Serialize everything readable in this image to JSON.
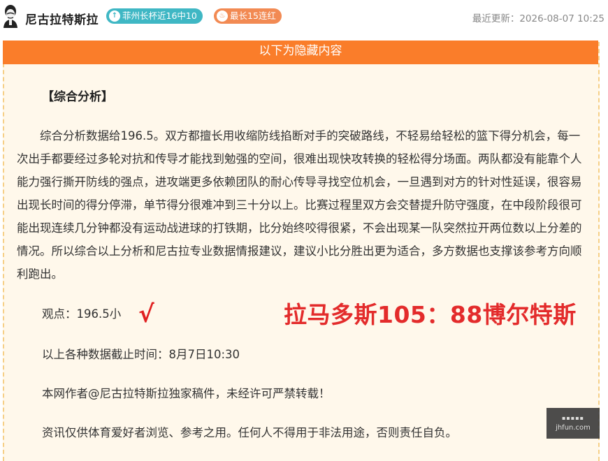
{
  "header": {
    "author": "尼古拉特斯拉",
    "badges": [
      {
        "icon": "up-arrow-icon",
        "label": "菲州长杯近16中10",
        "color": "#3fb7c4"
      },
      {
        "icon": "fire-icon",
        "label": "最长15连红",
        "color": "#f28a53"
      }
    ],
    "updated": "最近更新：2026-08-07 10:25"
  },
  "banner": "以下为隐藏内容",
  "article": {
    "section_title": "【综合分析】",
    "body": "综合分析数据给196.5。双方都擅长用收缩防线掐断对手的突破路线，不轻易给轻松的篮下得分机会，每一次出手都要经过多轮对抗和传导才能找到勉强的空间，很难出现快攻转换的轻松得分场面。两队都没有能靠个人能力强行撕开防线的强点，进攻端更多依赖团队的耐心传导寻找空位机会，一旦遇到对方的针对性延误，很容易出现长时间的得分停滞，单节得分很难冲到三十分以上。比赛过程里双方会交替提升防守强度，在中段阶段很可能出现连续几分钟都没有运动战进球的打铁期，比分始终咬得很紧，不会出现某一队突然拉开两位数以上分差的情况。所以综合以上分析和尼古拉专业数据情报建议，建议小比分胜出更为适合，多方数据也支撑该参考方向顺利跑出。",
    "viewpoint": "观点：196.5小",
    "check_mark": "√",
    "result": "拉马多斯105：88博尔特斯",
    "deadline": "以上各种数据截止时间：8月7日10:30",
    "copyright": "本网作者@尼古拉特斯拉独家稿件，未经许可严禁转载！",
    "disclaimer": "资讯仅供体育爱好者浏览、参考之用。任何人不得用于非法用途，否则责任自负。"
  },
  "watermark": {
    "top": "▪▪▪▪▪",
    "site": "jhfun.com"
  }
}
